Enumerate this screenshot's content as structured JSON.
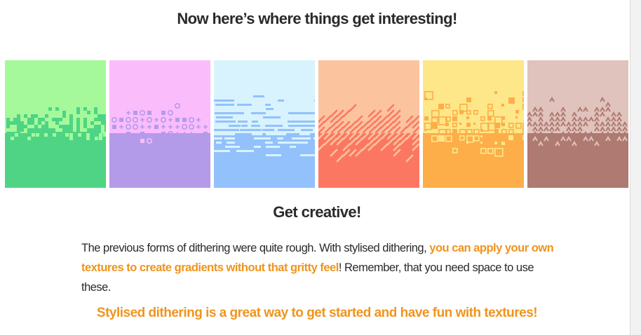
{
  "headings": {
    "top": "Now here’s where things get interesting!",
    "middle": "Get creative!"
  },
  "paragraph": {
    "part1": "The previous forms of dithering were quite rough. With stylised dithering, ",
    "highlight": "you can apply your own textures to create gradients without that gritty feel",
    "part2": "! Remember, that you need space to use these."
  },
  "callout": "Stylised dithering is a great way to get started and have fun with textures!",
  "swatches": [
    {
      "name": "green-checker",
      "style": "squares",
      "top": "#a5f99a",
      "bottom": "#4ed484"
    },
    {
      "name": "pink-circles",
      "style": "rings",
      "top": "#fbbcfc",
      "bottom": "#b39bea"
    },
    {
      "name": "blue-dashes",
      "style": "dashes",
      "top": "#d8f3fd",
      "bottom": "#93c1fc"
    },
    {
      "name": "orange-diagonals",
      "style": "slashes",
      "top": "#fcc39f",
      "bottom": "#fc7761"
    },
    {
      "name": "yellow-squares",
      "style": "boxes",
      "top": "#fde788",
      "bottom": "#fdae49"
    },
    {
      "name": "brown-zigzag",
      "style": "zigzag",
      "top": "#e0c3bc",
      "bottom": "#ae7a71"
    }
  ]
}
